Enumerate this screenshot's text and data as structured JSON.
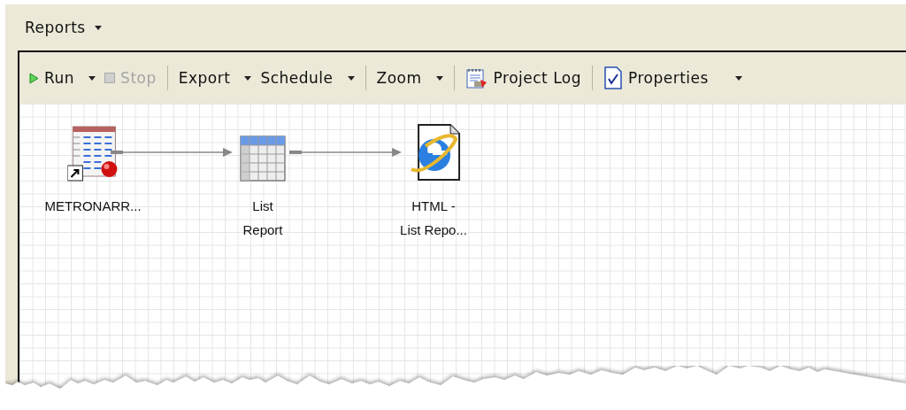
{
  "header": {
    "title": "Reports",
    "dropdown": true
  },
  "toolbar": [
    {
      "kind": "button",
      "label": "Run",
      "dropdown": true,
      "disabled": false
    },
    {
      "kind": "button",
      "label": "Stop",
      "dropdown": false,
      "disabled": true
    },
    {
      "kind": "separator"
    },
    {
      "kind": "button",
      "label": "Export",
      "dropdown": true,
      "disabled": false
    },
    {
      "kind": "button",
      "label": "Schedule",
      "dropdown": true,
      "disabled": false
    },
    {
      "kind": "separator"
    },
    {
      "kind": "button",
      "label": "Zoom",
      "dropdown": true,
      "disabled": false
    },
    {
      "kind": "separator"
    },
    {
      "kind": "button",
      "label": "Project Log",
      "dropdown": false,
      "disabled": false
    },
    {
      "kind": "separator"
    },
    {
      "kind": "button",
      "label": "Properties",
      "dropdown": true,
      "disabled": false
    }
  ],
  "nodes": [
    {
      "lines": [
        "METRONARR..."
      ]
    },
    {
      "lines": [
        "List",
        "Report"
      ]
    },
    {
      "lines": [
        "HTML -",
        "List Repo..."
      ]
    }
  ]
}
